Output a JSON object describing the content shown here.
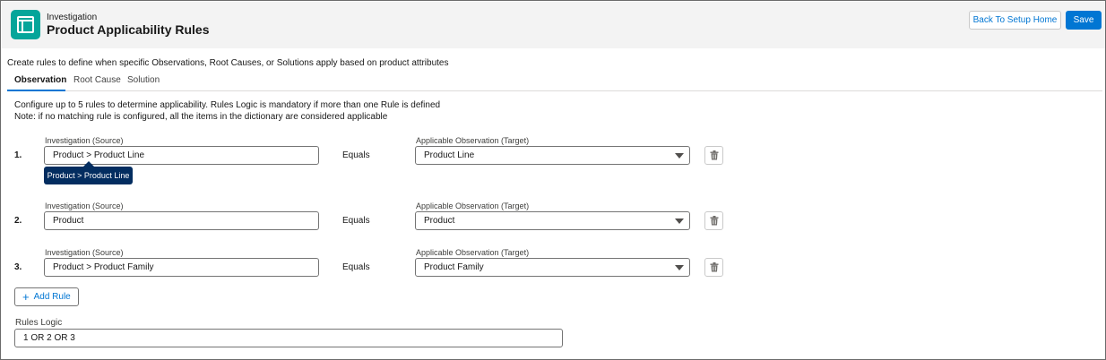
{
  "header": {
    "app_name": "Investigation",
    "title": "Product Applicability Rules",
    "back_button": "Back To Setup Home",
    "save_button": "Save",
    "icon": "table-layout-icon",
    "accent_color": "#04a59a"
  },
  "intro_text": "Create rules to define when specific Observations, Root Causes, or Solutions apply based on product attributes",
  "tabs": [
    {
      "label": "Observation",
      "active": true
    },
    {
      "label": "Root Cause",
      "active": false
    },
    {
      "label": "Solution",
      "active": false
    }
  ],
  "notes": {
    "line1": "Configure up to 5 rules to determine applicability. Rules Logic is mandatory if more than one Rule is defined",
    "line2": "Note: if no matching rule is configured, all the items in the dictionary are considered applicable"
  },
  "rules": [
    {
      "number": "1.",
      "source_label": "Investigation (Source)",
      "source_value": "Product > Product Line",
      "operator": "Equals",
      "target_label": "Applicable Observation (Target)",
      "target_value": "Product Line"
    },
    {
      "number": "2.",
      "source_label": "Investigation (Source)",
      "source_value": "Product",
      "operator": "Equals",
      "target_label": "Applicable Observation (Target)",
      "target_value": "Product"
    },
    {
      "number": "3.",
      "source_label": "Investigation (Source)",
      "source_value": "Product > Product Family",
      "operator": "Equals",
      "target_label": "Applicable Observation (Target)",
      "target_value": "Product Family"
    }
  ],
  "tooltip": "Product > Product Line",
  "add_rule_label": "Add Rule",
  "rules_logic": {
    "label": "Rules Logic",
    "value": "1 OR 2 OR 3"
  },
  "colors": {
    "brand": "#0176d3",
    "tooltip_bg": "#032d60"
  }
}
